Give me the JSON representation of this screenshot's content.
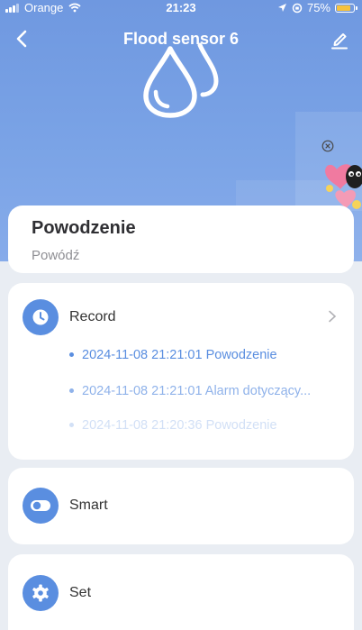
{
  "status_bar": {
    "carrier": "Orange",
    "time": "21:23",
    "battery": "75%",
    "battery_level": 0.75
  },
  "header": {
    "title": "Flood sensor 6",
    "back_icon": "chevron-left-icon",
    "edit_icon": "pencil-icon",
    "hero_icon": "water-drops-icon"
  },
  "status": {
    "title": "Powodzenie",
    "subtitle": "Powódź"
  },
  "record": {
    "label": "Record",
    "icon": "clock-icon",
    "items": [
      "2024-11-08 21:21:01 Powodzenie",
      "2024-11-08 21:21:01 Alarm dotyczący...",
      "2024-11-08 21:20:36 Powodzenie"
    ]
  },
  "smart": {
    "label": "Smart",
    "icon": "toggle-icon"
  },
  "set": {
    "label": "Set",
    "icon": "gear-icon"
  },
  "colors": {
    "accent": "#5a8ee0",
    "hero_background": "#7aa3e6"
  }
}
